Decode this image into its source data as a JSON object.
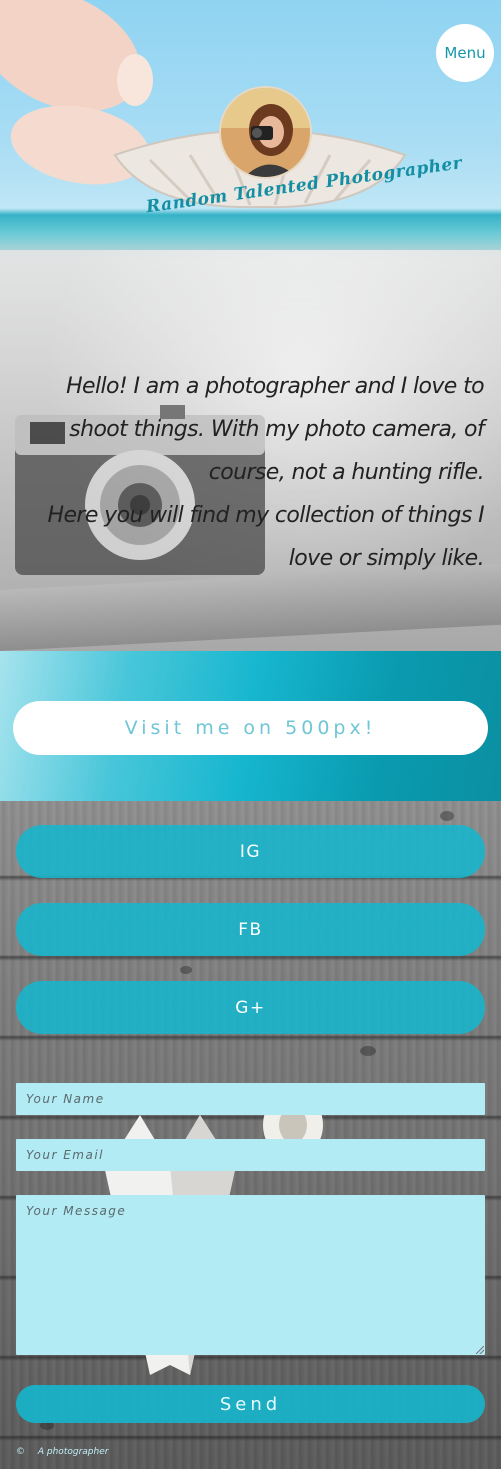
{
  "header": {
    "menu_label": "Menu",
    "site_title": "Random Talented Photographer"
  },
  "intro": {
    "paragraph1": "Hello! I am a photographer and I love to shoot things. With my photo camera, of course, not a hunting rifle.",
    "paragraph2": "Here you will find my collection of things I love or simply like."
  },
  "cta": {
    "label": "Visit me on 500px!"
  },
  "social": {
    "items": [
      "IG",
      "FB",
      "G+"
    ]
  },
  "contact_form": {
    "name_placeholder": "Your Name",
    "email_placeholder": "Your Email",
    "message_placeholder": "Your Message",
    "send_label": "Send"
  },
  "footer": {
    "copyright_symbol": "©",
    "text": "A photographer"
  },
  "colors": {
    "accent": "#16b6cd",
    "field_bg": "#b2ebf4",
    "title_teal": "#138ea2"
  }
}
